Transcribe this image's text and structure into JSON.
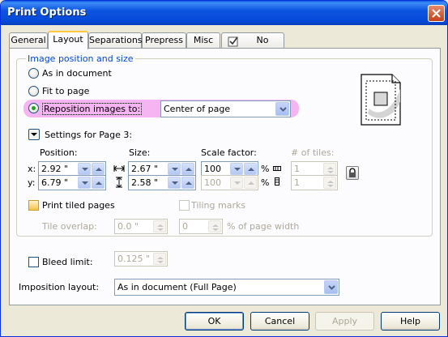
{
  "window": {
    "title": "Print Options"
  },
  "tabs": [
    {
      "label": "General"
    },
    {
      "label": "Layout"
    },
    {
      "label": "Separations"
    },
    {
      "label": "Prepress"
    },
    {
      "label": "Misc"
    },
    {
      "label": "No Issues"
    }
  ],
  "image_position": {
    "group_label": "Image position and size",
    "option_as_in_document": "As in document",
    "option_fit_to_page": "Fit to page",
    "option_reposition": "Reposition images to:",
    "reposition_value": "Center of page",
    "selected": "reposition"
  },
  "settings": {
    "label": "Settings for Page 3:",
    "position_label": "Position:",
    "size_label": "Size:",
    "scale_label": "Scale factor:",
    "tiles_label": "# of tiles:",
    "x_label": "x:",
    "y_label": "y:",
    "pos_x": "2.92 \"",
    "pos_y": "6.79 \"",
    "size_w": "2.67 \"",
    "size_h": "2.58 \"",
    "scale_x": "100",
    "scale_y": "100",
    "percent1": "%",
    "percent2": "%",
    "tiles_x": "1",
    "tiles_y": "1"
  },
  "tiling": {
    "print_tiled_label": "Print tiled pages",
    "tiling_marks_label": "Tiling marks",
    "tile_overlap_label": "Tile overlap:",
    "tile_overlap_value": "0.0 \"",
    "tile_overlap_pct": "0",
    "pct_page_width_label": "% of page width"
  },
  "bleed": {
    "label": "Bleed limit:",
    "value": "0.125 \""
  },
  "imposition": {
    "label": "Imposition layout:",
    "value": "As in document (Full Page)"
  },
  "buttons": {
    "ok": "OK",
    "cancel": "Cancel",
    "apply": "Apply",
    "help": "Help"
  },
  "colors": {
    "highlight": "#f5a7f0",
    "titlebar": "#0c55e0",
    "group_label": "#0046d5"
  }
}
